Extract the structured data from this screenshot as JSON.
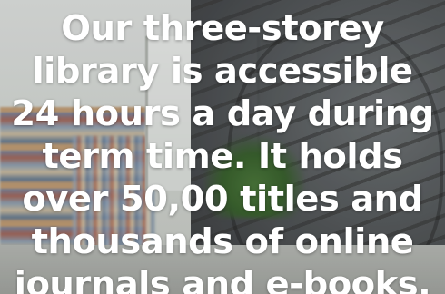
{
  "caption": {
    "lines": [
      "Our three-storey",
      "library is accessible",
      "24 hours a day during",
      "term time. It holds",
      "over 50,00 titles and",
      "thousands of online",
      "journals and e-books."
    ]
  }
}
